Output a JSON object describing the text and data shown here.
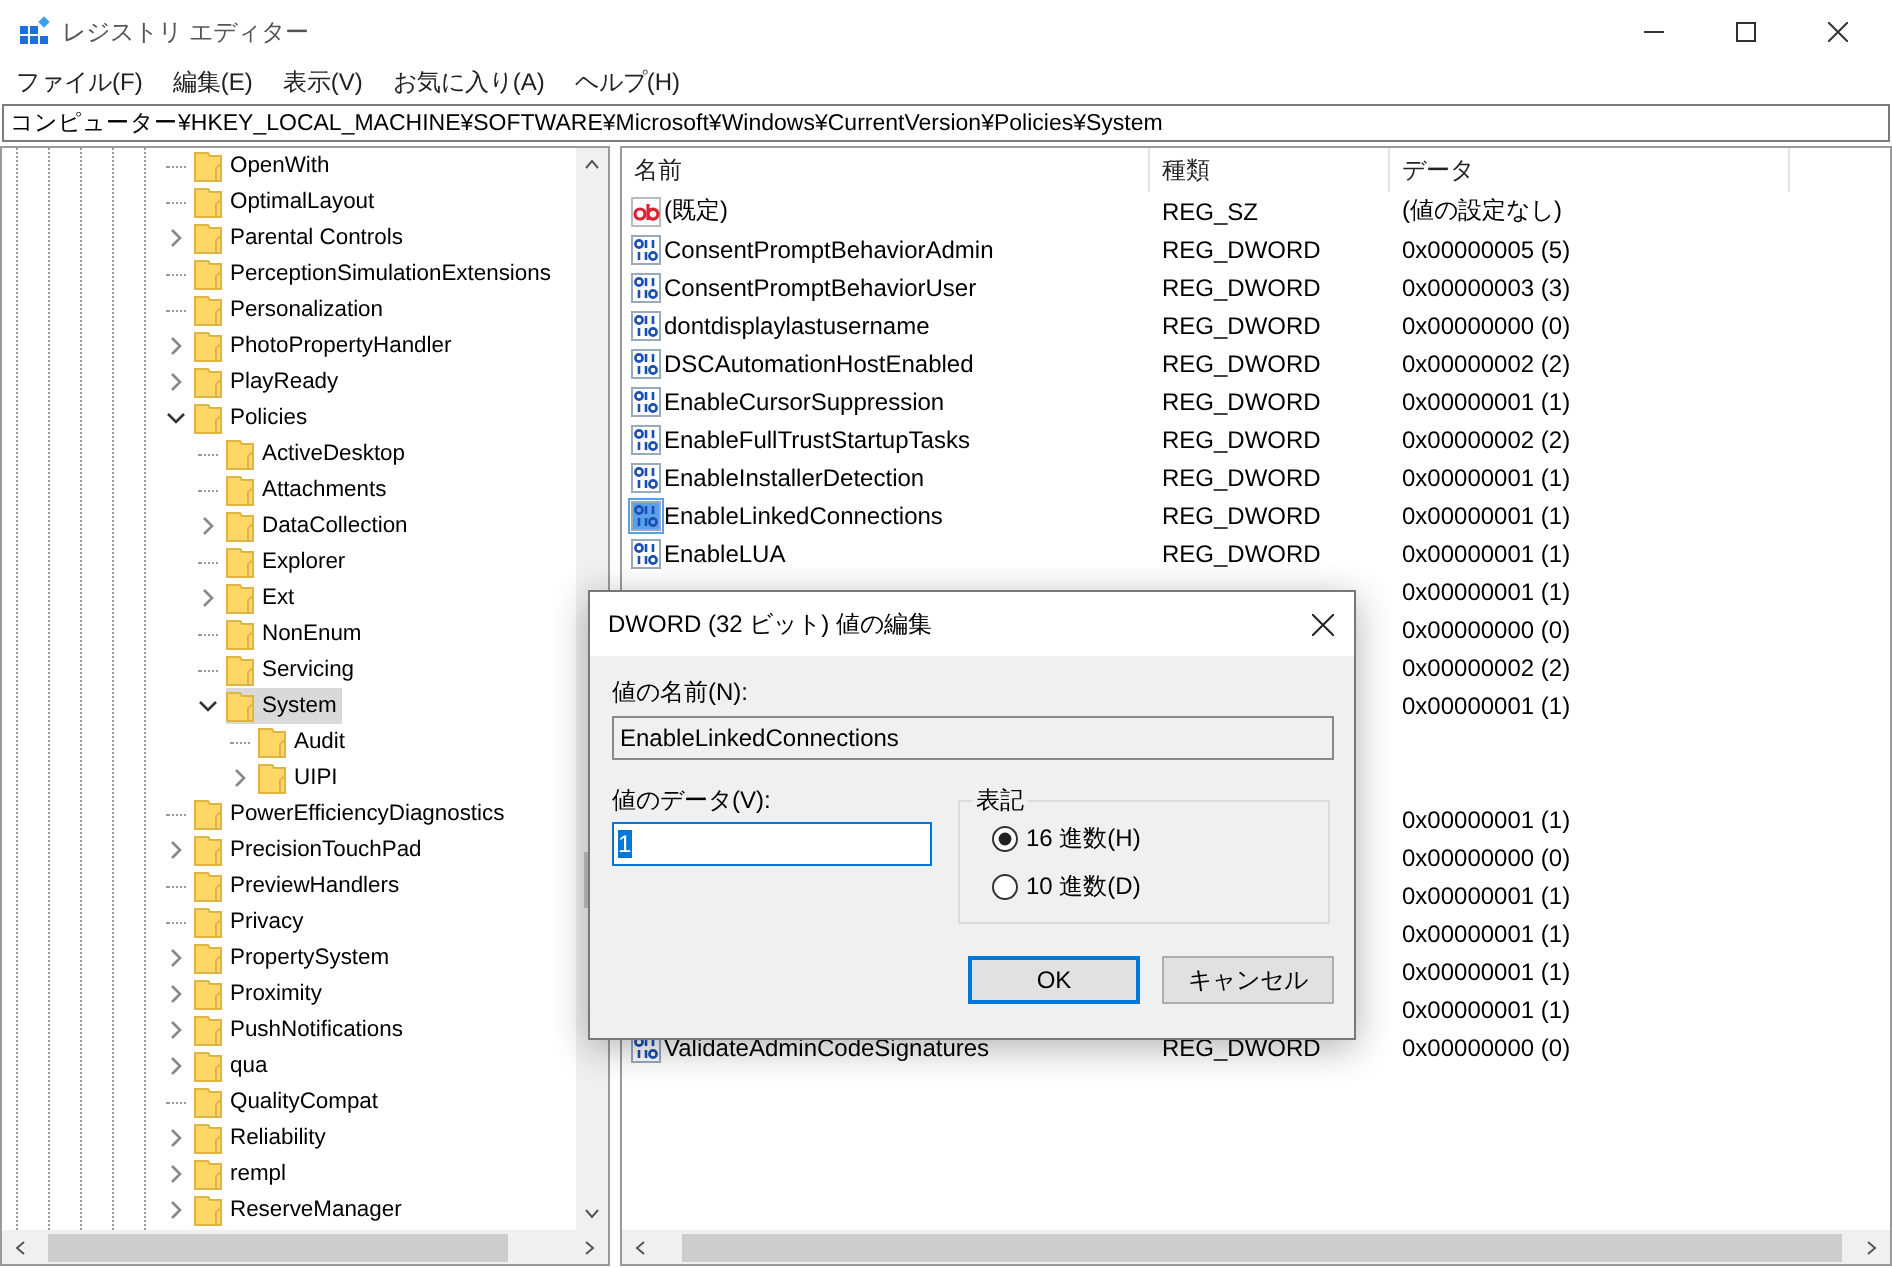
{
  "window": {
    "title": "レジストリ エディター"
  },
  "menu": [
    "ファイル(F)",
    "編集(E)",
    "表示(V)",
    "お気に入り(A)",
    "ヘルプ(H)"
  ],
  "address": "コンピューター¥HKEY_LOCAL_MACHINE¥SOFTWARE¥Microsoft¥Windows¥CurrentVersion¥Policies¥System",
  "tree": [
    {
      "label": "OpenWith",
      "expandable": false,
      "selected": false
    },
    {
      "label": "OptimalLayout",
      "expandable": false,
      "selected": false
    },
    {
      "label": "Parental Controls",
      "expandable": true,
      "expanded": false,
      "selected": false
    },
    {
      "label": "PerceptionSimulationExtensions",
      "expandable": false,
      "selected": false
    },
    {
      "label": "Personalization",
      "expandable": false,
      "selected": false
    },
    {
      "label": "PhotoPropertyHandler",
      "expandable": true,
      "expanded": false,
      "selected": false
    },
    {
      "label": "PlayReady",
      "expandable": true,
      "expanded": false,
      "selected": false
    },
    {
      "label": "Policies",
      "expandable": true,
      "expanded": true,
      "selected": false,
      "children": [
        {
          "label": "ActiveDesktop",
          "expandable": false,
          "selected": false
        },
        {
          "label": "Attachments",
          "expandable": false,
          "selected": false
        },
        {
          "label": "DataCollection",
          "expandable": true,
          "expanded": false,
          "selected": false
        },
        {
          "label": "Explorer",
          "expandable": false,
          "selected": false
        },
        {
          "label": "Ext",
          "expandable": true,
          "expanded": false,
          "selected": false
        },
        {
          "label": "NonEnum",
          "expandable": false,
          "selected": false
        },
        {
          "label": "Servicing",
          "expandable": false,
          "selected": false
        },
        {
          "label": "System",
          "expandable": true,
          "expanded": true,
          "selected": true,
          "children": [
            {
              "label": "Audit",
              "expandable": false,
              "selected": false
            },
            {
              "label": "UIPI",
              "expandable": true,
              "expanded": false,
              "selected": false
            }
          ]
        }
      ]
    },
    {
      "label": "PowerEfficiencyDiagnostics",
      "expandable": false,
      "selected": false
    },
    {
      "label": "PrecisionTouchPad",
      "expandable": true,
      "expanded": false,
      "selected": false
    },
    {
      "label": "PreviewHandlers",
      "expandable": false,
      "selected": false
    },
    {
      "label": "Privacy",
      "expandable": false,
      "selected": false
    },
    {
      "label": "PropertySystem",
      "expandable": true,
      "expanded": false,
      "selected": false
    },
    {
      "label": "Proximity",
      "expandable": true,
      "expanded": false,
      "selected": false
    },
    {
      "label": "PushNotifications",
      "expandable": true,
      "expanded": false,
      "selected": false
    },
    {
      "label": "qua",
      "expandable": true,
      "expanded": false,
      "selected": false
    },
    {
      "label": "QualityCompat",
      "expandable": false,
      "selected": false
    },
    {
      "label": "Reliability",
      "expandable": true,
      "expanded": false,
      "selected": false
    },
    {
      "label": "rempl",
      "expandable": true,
      "expanded": false,
      "selected": false
    },
    {
      "label": "ReserveManager",
      "expandable": true,
      "expanded": false,
      "selected": false
    }
  ],
  "list": {
    "columns": [
      "名前",
      "種類",
      "データ"
    ],
    "rows": [
      {
        "kind": "string",
        "name": "(既定)",
        "type": "REG_SZ",
        "data": "(値の設定なし)",
        "selected": false
      },
      {
        "kind": "dword",
        "name": "ConsentPromptBehaviorAdmin",
        "type": "REG_DWORD",
        "data": "0x00000005 (5)",
        "selected": false
      },
      {
        "kind": "dword",
        "name": "ConsentPromptBehaviorUser",
        "type": "REG_DWORD",
        "data": "0x00000003 (3)",
        "selected": false
      },
      {
        "kind": "dword",
        "name": "dontdisplaylastusername",
        "type": "REG_DWORD",
        "data": "0x00000000 (0)",
        "selected": false
      },
      {
        "kind": "dword",
        "name": "DSCAutomationHostEnabled",
        "type": "REG_DWORD",
        "data": "0x00000002 (2)",
        "selected": false
      },
      {
        "kind": "dword",
        "name": "EnableCursorSuppression",
        "type": "REG_DWORD",
        "data": "0x00000001 (1)",
        "selected": false
      },
      {
        "kind": "dword",
        "name": "EnableFullTrustStartupTasks",
        "type": "REG_DWORD",
        "data": "0x00000002 (2)",
        "selected": false
      },
      {
        "kind": "dword",
        "name": "EnableInstallerDetection",
        "type": "REG_DWORD",
        "data": "0x00000001 (1)",
        "selected": false
      },
      {
        "kind": "dword",
        "name": "EnableLinkedConnections",
        "type": "REG_DWORD",
        "data": "0x00000001 (1)",
        "selected": true
      },
      {
        "kind": "dword",
        "name": "EnableLUA",
        "type": "REG_DWORD",
        "data": "0x00000001 (1)",
        "selected": false
      },
      {
        "data": "0x00000001 (1)"
      },
      {
        "data": "0x00000000 (0)"
      },
      {
        "data": "0x00000002 (2)"
      },
      {
        "data": "0x00000001 (1)"
      },
      {},
      {},
      {
        "data": "0x00000001 (1)"
      },
      {
        "data": "0x00000000 (0)"
      },
      {
        "data": "0x00000001 (1)"
      },
      {
        "data": "0x00000001 (1)"
      },
      {
        "data": "0x00000001 (1)"
      },
      {
        "data": "0x00000001 (1)"
      },
      {
        "kind": "dword",
        "name": "ValidateAdminCodeSignatures",
        "type": "REG_DWORD",
        "data": "0x00000000 (0)",
        "selected": false
      }
    ]
  },
  "dialog": {
    "title": "DWORD (32 ビット) 値の編集",
    "name_label": "値の名前(N):",
    "name_value": "EnableLinkedConnections",
    "data_label": "値のデータ(V):",
    "data_value": "1",
    "base_group": "表記",
    "bases": [
      {
        "label": "16 進数(H)",
        "selected": true
      },
      {
        "label": "10 進数(D)",
        "selected": false
      }
    ],
    "buttons": [
      {
        "label": "OK",
        "default": true
      },
      {
        "label": "キャンセル",
        "default": false
      }
    ]
  }
}
